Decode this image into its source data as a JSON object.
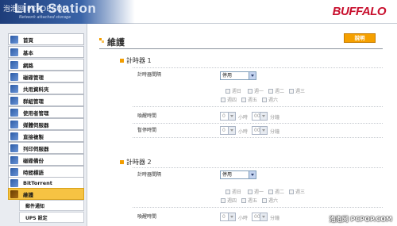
{
  "header": {
    "app_title": "Link Station",
    "app_subtitle": "Network attached storage",
    "watermark": "泡泡网 PCPOP.COM",
    "brand": "BUFFALO"
  },
  "sidebar": {
    "items": [
      {
        "label": "首頁"
      },
      {
        "label": "基本"
      },
      {
        "label": "網路"
      },
      {
        "label": "磁碟管理"
      },
      {
        "label": "共用資料夾"
      },
      {
        "label": "群組管理"
      },
      {
        "label": "使用者管理"
      },
      {
        "label": "媒體伺服器"
      },
      {
        "label": "直接複製"
      },
      {
        "label": "列印伺服器"
      },
      {
        "label": "磁碟備份"
      },
      {
        "label": "時間標語"
      },
      {
        "label": "BitTorrent"
      },
      {
        "label": "維護"
      }
    ],
    "subitems": [
      {
        "label": "郵件通知"
      },
      {
        "label": "UPS 設定"
      }
    ]
  },
  "main": {
    "title": "維護",
    "help_label": "說明",
    "timer1": {
      "title": "計時器 1",
      "interval_label": "計時器間隔",
      "interval_value": "停用",
      "days": [
        "週日",
        "週一",
        "週二",
        "週三",
        "週四",
        "週五",
        "週六"
      ],
      "wake_label": "喚醒時間",
      "sleep_label": "暫停時間",
      "hour_value": "0",
      "minute_value": "00",
      "hour_unit": "小時",
      "minute_unit": "分鐘"
    },
    "timer2": {
      "title": "計時器 2",
      "interval_label": "計時器間隔",
      "interval_value": "停用",
      "days": [
        "週日",
        "週一",
        "週二",
        "週三",
        "週四",
        "週五",
        "週六"
      ],
      "wake_label": "喚醒時間",
      "hour_value": "0",
      "minute_value": "00",
      "hour_unit": "小時",
      "minute_unit": "分鐘"
    }
  },
  "footer": {
    "watermark": "泡泡网 PCPOP.COM"
  }
}
